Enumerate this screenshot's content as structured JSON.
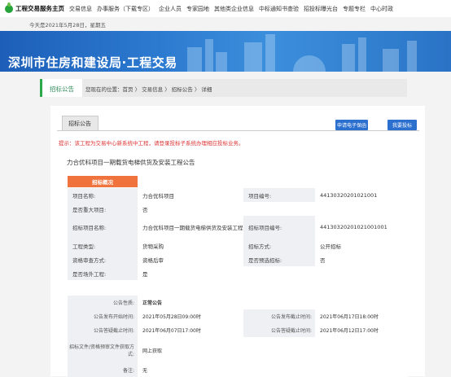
{
  "nav": {
    "home": "工程交易服务主页",
    "items": [
      "交易信息",
      "办事服务（下载专区）",
      "企业人员",
      "专家园地",
      "其他类企业信息",
      "中标通知书查验",
      "招投标曝光台",
      "专题专栏",
      "中心时政"
    ]
  },
  "date_text": "今天是2021年5月28日，星期五",
  "banner_title": "深圳市住房和建设局·工程交易",
  "breadcrumb": {
    "tab": "招标公告",
    "path": "您现在的位置：首页 〉 交易信息 〉 招标公告 〉 详细"
  },
  "card": {
    "tab": "招标公告",
    "btn_apply": "申请电子保函",
    "btn_bid": "我要投标",
    "tip": "提示：该工程为交易中心新系统中工程，请登录投标子系统办理相应投标业务。",
    "project_title": "力合优科项目一期载货电梯供货及安装工程公告",
    "section_tag": "招标概况"
  },
  "summary": [
    [
      "项目名称:",
      "力合优科项目",
      "项目编号:",
      "44130320201021001"
    ],
    [
      "是否重大项目:",
      "否",
      "",
      ""
    ],
    [
      "招标项目名称:",
      "力合优科项目一期载货电梯供货及安装工程",
      "招标项目编号:",
      "44130320201021001001"
    ],
    [
      "工程类型:",
      "货物采购",
      "招标方式:",
      "公开招标"
    ],
    [
      "资格审查方式:",
      "资格后审",
      "是否预选招标:",
      "否"
    ],
    [
      "是否场外工程:",
      "是",
      "",
      ""
    ]
  ],
  "notice": {
    "nature_label": "公告性质:",
    "nature_value": "正常公告",
    "rows": [
      [
        "公告发布开始时间:",
        "2021年05月28日09:00时",
        "公告发布截止时间:",
        "2021年06月17日18:00时"
      ],
      [
        "公告答疑截止时间:",
        "2021年06月07日17:00时",
        "公告答疑截止时间:",
        "2021年06月12日17:00时"
      ]
    ],
    "doc_label": "招标文件/资格预审文件获取方式:",
    "doc_value": "网上获取",
    "remark_label": "备注:",
    "remark_value": "无"
  }
}
